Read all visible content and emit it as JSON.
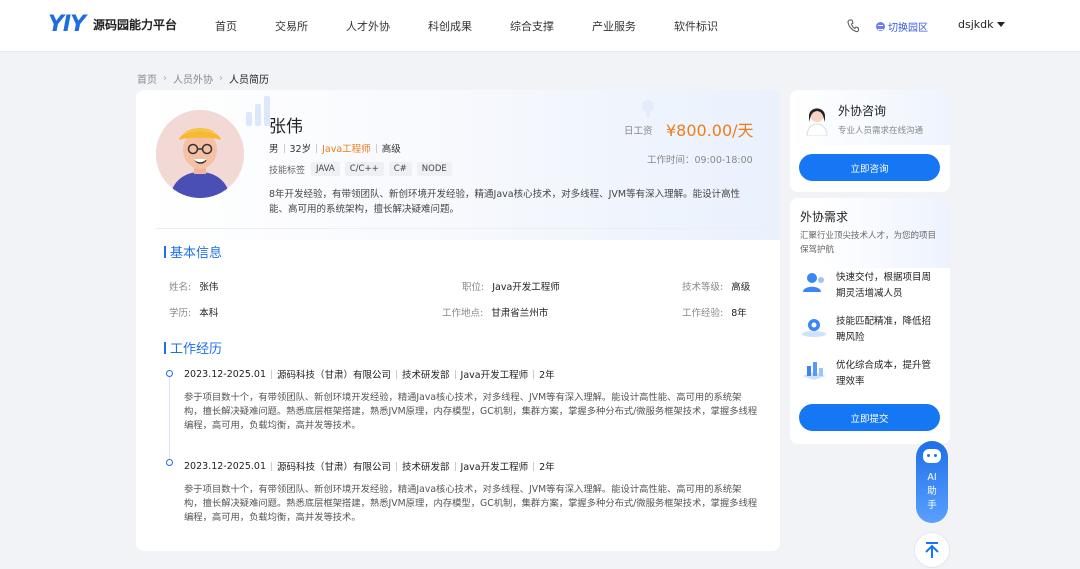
{
  "header": {
    "logo_mark": "YIY",
    "logo_text": "源码园能力平台",
    "nav": [
      "首页",
      "交易所",
      "人才外协",
      "科创成果",
      "综合支撑",
      "产业服务",
      "软件标识"
    ],
    "switch_label": "切换园区",
    "user": "dsjkdk"
  },
  "breadcrumb": [
    "首页",
    "人员外协",
    "人员简历"
  ],
  "profile": {
    "name": "张伟",
    "gender": "男",
    "age": "32岁",
    "job": "Java工程师",
    "level": "高级",
    "skills_label": "技能标签",
    "skills": [
      "JAVA",
      "C/C++",
      "C#",
      "NODE"
    ],
    "intro": "8年开发经验，有带领团队、新创环境开发经验，精通Java核心技术，对多线程、JVM等有深入理解。能设计高性能、高可用的系统架构，擅长解决疑难问题。",
    "wage_label": "日工资",
    "wage": "¥800.00/天",
    "work_time": "工作时间：09:00-18:00"
  },
  "basic_info": {
    "title": "基本信息",
    "name_k": "姓名:",
    "name_v": "张伟",
    "position_k": "职位:",
    "position_v": "Java开发工程师",
    "tech_k": "技术等级:",
    "tech_v": "高级",
    "edu_k": "学历:",
    "edu_v": "本科",
    "place_k": "工作地点:",
    "place_v": "甘肃省兰州市",
    "exp_k": "工作经验:",
    "exp_v": "8年"
  },
  "work_exp": {
    "title": "工作经历",
    "items": [
      {
        "period": "2023.12-2025.01",
        "company": "源码科技（甘肃）有限公司",
        "dept": "技术研发部",
        "role": "Java开发工程师",
        "years": "2年",
        "desc": "参于项目数十个，有带领团队、新创环境开发经验，精通Java核心技术，对多线程、JVM等有深入理解。能设计高性能、高可用的系统架构，擅长解决疑难问题。熟悉底层框架搭建，熟悉JVM原理，内存模型，GC机制，集群方案，掌握多种分布式/微服务框架技术，掌握多线程编程，高可用，负载均衡，高并发等技术。"
      },
      {
        "period": "2023.12-2025.01",
        "company": "源码科技（甘肃）有限公司",
        "dept": "技术研发部",
        "role": "Java开发工程师",
        "years": "2年",
        "desc": "参于项目数十个，有带领团队、新创环境开发经验，精通Java核心技术，对多线程、JVM等有深入理解。能设计高性能、高可用的系统架构，擅长解决疑难问题。熟悉底层框架搭建，熟悉JVM原理，内存模型，GC机制，集群方案，掌握多种分布式/微服务框架技术，掌握多线程编程，高可用，负载均衡，高并发等技术。"
      }
    ]
  },
  "consult": {
    "title": "外协咨询",
    "subtitle": "专业人员需求在线沟通",
    "button": "立即咨询"
  },
  "demand": {
    "title": "外协需求",
    "desc": "汇聚行业顶尖技术人才，为您的项目保驾护航",
    "features": [
      "快速交付，根据项目周期灵活增减人员",
      "技能匹配精准，降低招聘风险",
      "优化综合成本，提升管理效率"
    ],
    "button": "立即提交"
  },
  "ai": {
    "label": "AI助手"
  },
  "colors": {
    "primary": "#1677f5",
    "accent": "#f07c1a"
  }
}
